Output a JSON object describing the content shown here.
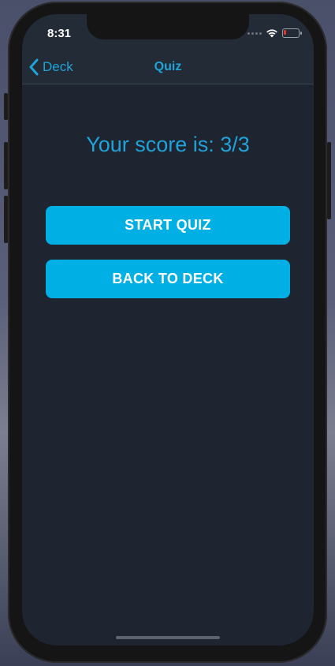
{
  "status_bar": {
    "time": "8:31",
    "battery_color": "#e2352b"
  },
  "nav": {
    "back_label": "Deck",
    "title": "Quiz",
    "accent_color": "#1fa3d9"
  },
  "main": {
    "score_text": "Your score is: 3/3",
    "buttons": [
      {
        "label": "START QUIZ"
      },
      {
        "label": "BACK TO DECK"
      }
    ],
    "button_color": "#00b0e4"
  },
  "icons": {
    "back": "chevron-left-icon",
    "wifi": "wifi-icon",
    "battery": "battery-icon"
  }
}
